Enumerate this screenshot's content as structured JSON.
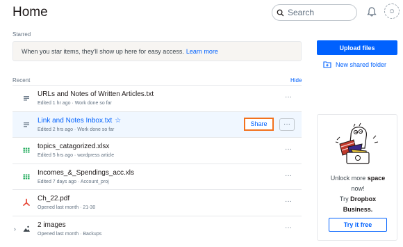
{
  "header": {
    "title": "Home",
    "search_placeholder": "Search"
  },
  "starred": {
    "label": "Starred",
    "message": "When you star items, they'll show up here for easy access.",
    "link": "Learn more"
  },
  "recent": {
    "label": "Recent",
    "hide": "Hide",
    "share_label": "Share",
    "more_label": "···",
    "items": [
      {
        "name": "URLs and Notes of Written Articles.txt",
        "meta": "Edited 1 hr ago · Work done so far",
        "icon": "text-file-icon"
      },
      {
        "name": "Link and Notes Inbox.txt",
        "meta": "Edited 2 hrs ago · Work done so far",
        "icon": "text-file-icon"
      },
      {
        "name": "topics_catagorized.xlsx",
        "meta": "Edited 5 hrs ago · wordpress article",
        "icon": "spreadsheet-icon"
      },
      {
        "name": "Incomes_&_Spendings_acc.xls",
        "meta": "Edited 7 days ago · Account_proj",
        "icon": "spreadsheet-icon"
      },
      {
        "name": "Ch_22.pdf",
        "meta": "Opened last month · 21-30",
        "icon": "pdf-icon"
      },
      {
        "name": "2 images",
        "meta": "Opened last month · Backups",
        "icon": "images-icon"
      }
    ]
  },
  "sidebar": {
    "upload": "Upload files",
    "new_folder": "New shared folder"
  },
  "promo": {
    "line1": "Unlock more",
    "line1_bold": "space",
    "line2": "now!",
    "line3": "Try",
    "line3_bold": "Dropbox",
    "line4_bold": "Business.",
    "button": "Try it free"
  },
  "colors": {
    "accent": "#0061fe",
    "highlight": "#f2711c",
    "spreadsheet": "#27ae60",
    "pdf": "#e74c3c"
  }
}
